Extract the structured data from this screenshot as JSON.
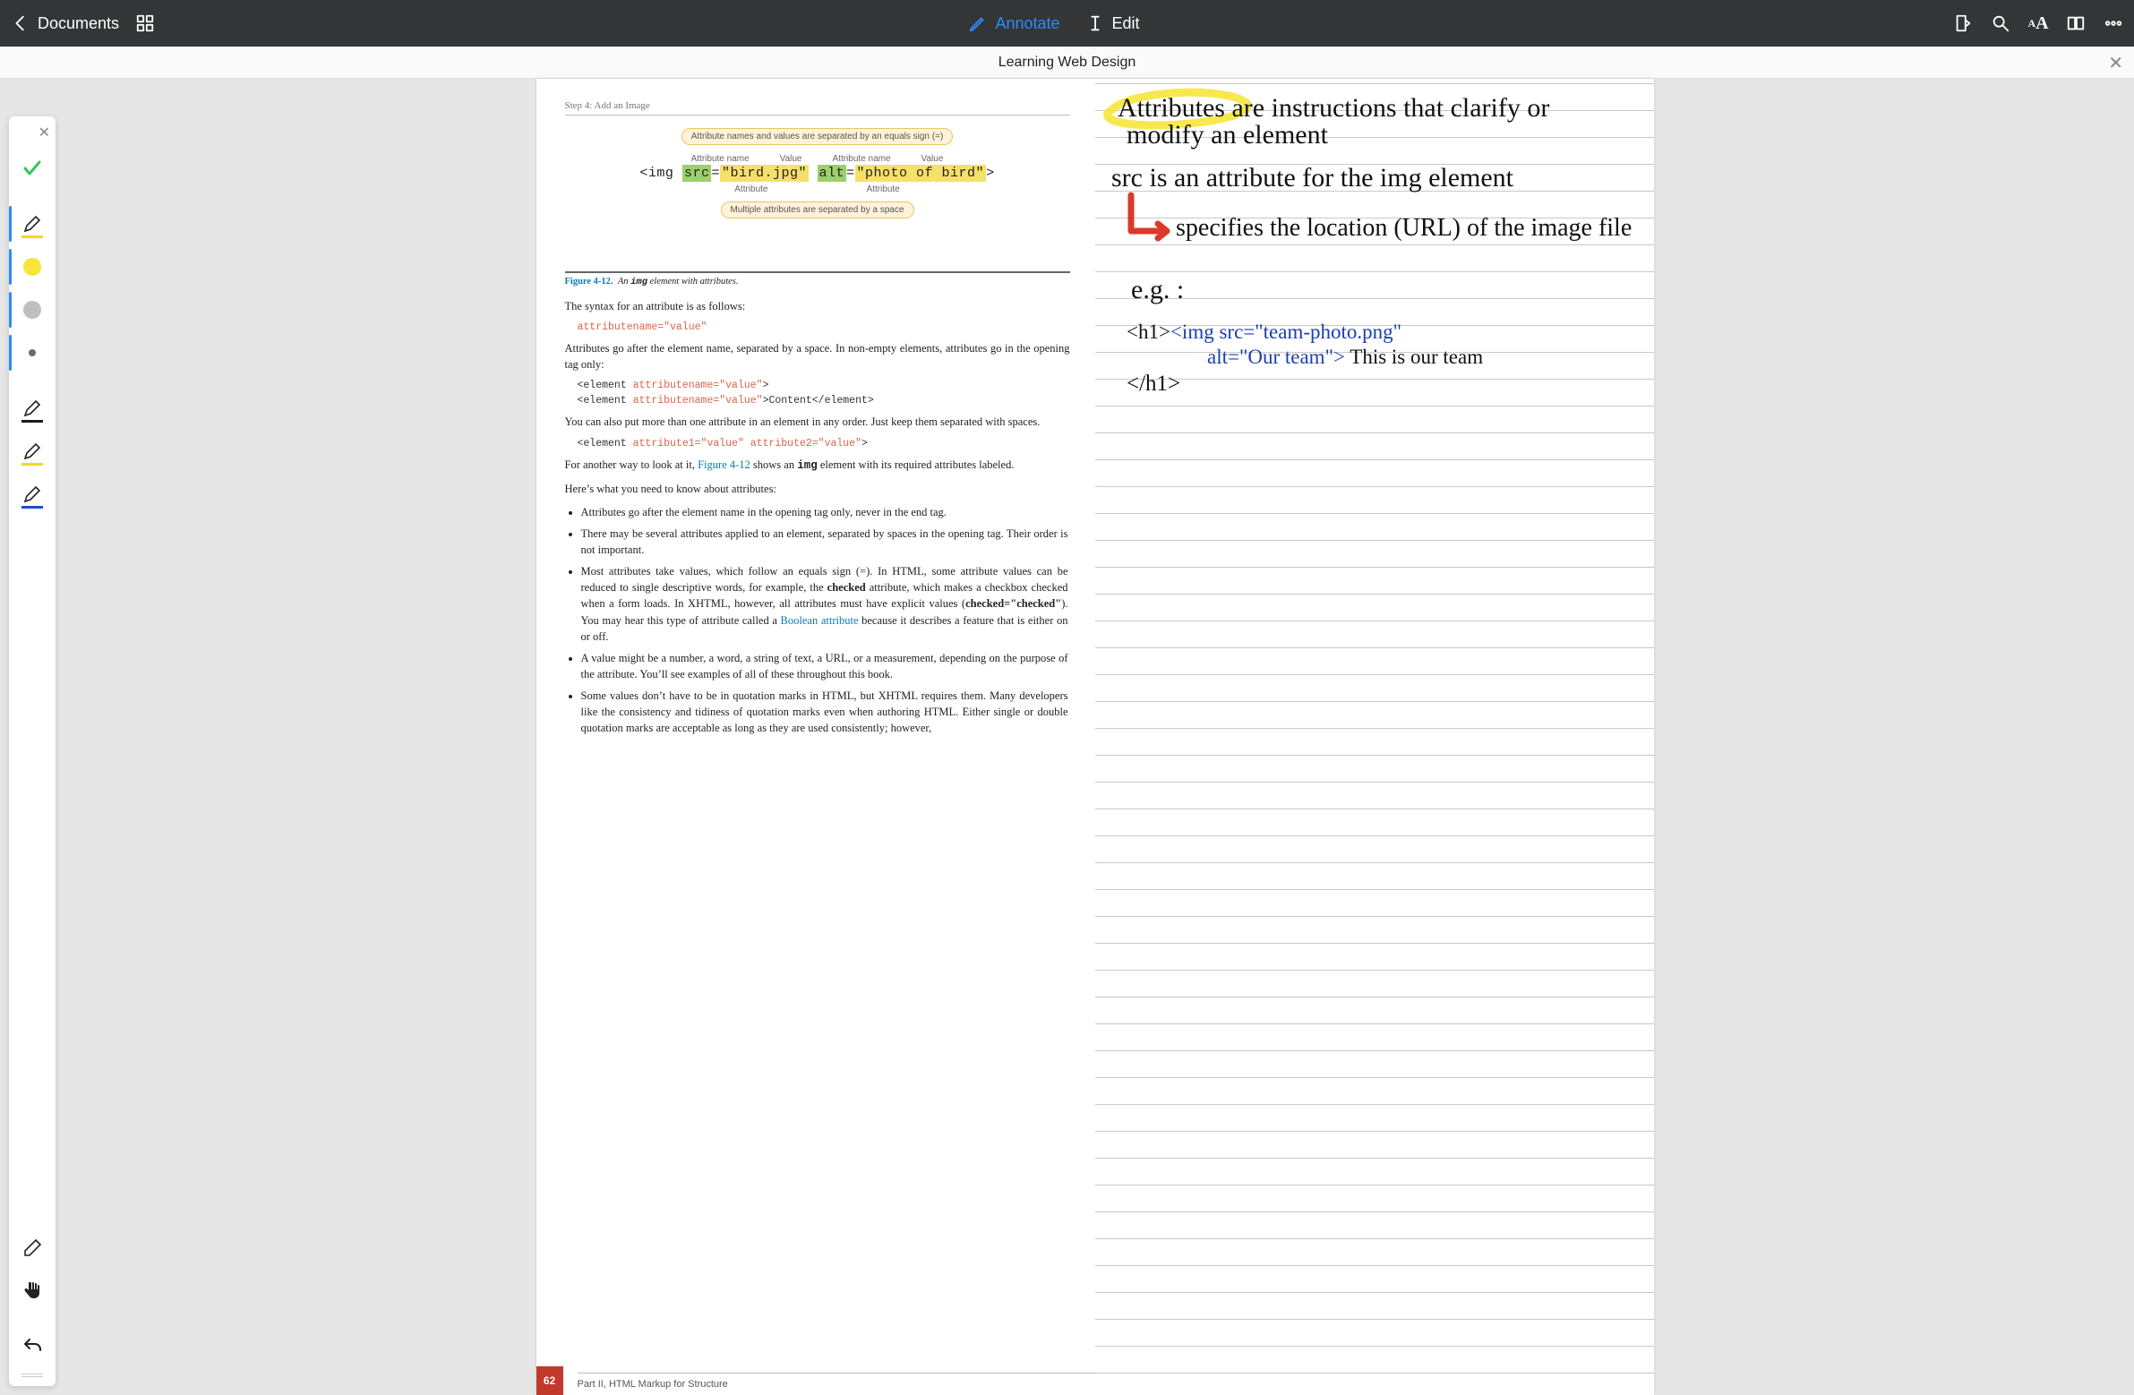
{
  "toolbar": {
    "back_label": "Documents",
    "mode_annotate": "Annotate",
    "mode_edit": "Edit"
  },
  "titlebar": {
    "doc_title": "Learning Web Design"
  },
  "palette": {
    "tools": [
      {
        "name": "done-check",
        "type": "check"
      },
      {
        "name": "pen-tool-yellow",
        "type": "pen",
        "underline": "#f2d531"
      },
      {
        "name": "color-yellow",
        "type": "swatch",
        "color": "#f6e63c"
      },
      {
        "name": "color-gray",
        "type": "swatch",
        "color": "#bfbfbf"
      },
      {
        "name": "color-dot",
        "type": "swatch",
        "color": "#6b6b6b",
        "small": true
      },
      {
        "name": "pen-black",
        "type": "pen",
        "underline": "#1c1c1c"
      },
      {
        "name": "pen-yellow2",
        "type": "pen",
        "underline": "#f2d531"
      },
      {
        "name": "pen-blue",
        "type": "pen",
        "underline": "#1850c9"
      },
      {
        "name": "eraser-tool",
        "type": "eraser"
      },
      {
        "name": "hand-tool",
        "type": "hand"
      },
      {
        "name": "undo-tool",
        "type": "undo"
      }
    ]
  },
  "book": {
    "step_header": "Step 4: Add an Image",
    "diagram": {
      "callout_top": "Attribute names and values are separated by an equals sign (=)",
      "label_attr_name": "Attribute name",
      "label_value": "Value",
      "code": "<img src=\"bird.jpg\" alt=\"photo of bird\">",
      "code_parts": {
        "open": "<img ",
        "a1n": "src",
        "eq": "=",
        "a1v": "\"bird.jpg\"",
        "sp": " ",
        "a2n": "alt",
        "a2v": "\"photo of bird\"",
        "close": ">"
      },
      "label_attribute": "Attribute",
      "callout_bot": "Multiple attributes are separated by a space"
    },
    "fig": {
      "num": "Figure 4-12.",
      "rest_a": "An ",
      "mono": "img",
      "rest_b": " element with attributes."
    },
    "p1": "The syntax for an attribute is as follows:",
    "code1": "attributename=\"value\"",
    "p2": "Attributes go after the element name, separated by a space. In non-empty elements, attributes go in the opening tag only:",
    "code2a_pre": "<element ",
    "code2a_attr": "attributename=\"value\"",
    "code2a_post": ">",
    "code2b_pre": "<element ",
    "code2b_attr": "attributename=\"value\"",
    "code2b_post": ">Content</element>",
    "p3": "You can also put more than one attribute in an element in any order. Just keep them separated with spaces.",
    "code3_pre": "<element ",
    "code3_a1": "attribute1=\"value\"",
    "code3_sp": " ",
    "code3_a2": "attribute2=\"value\"",
    "code3_post": ">",
    "p4a": "For another way to look at it, ",
    "p4_link": "Figure 4-12",
    "p4b": " shows an ",
    "p4_mono": "img",
    "p4c": " element with its required attributes labeled.",
    "p5": "Here’s what you need to know about attributes:",
    "bullets": [
      "Attributes go after the element name in the opening tag only, never in the end tag.",
      "There may be several attributes applied to an element, separated by spaces in the opening tag. Their order is not important.",
      "",
      "A value might be a number, a word, a string of text, a URL, or a measurement, depending on the purpose of the attribute. You’ll see examples of all of these throughout this book.",
      "Some values don’t have to be in quotation marks in HTML, but XHTML requires them. Many developers like the consistency and tidiness of quotation marks even when authoring HTML. Either single or double quotation marks are acceptable as long as they are used consistently; however,"
    ],
    "bullet3": {
      "a": "Most attributes take values, which follow an equals sign (=). In HTML, some attribute values can be reduced to single descriptive words, for example, the ",
      "b_bold": "checked",
      "c": " attribute, which makes a checkbox checked when a form loads. In XHTML, however, all attributes must have explicit values (",
      "d_bold": "checked=\"checked\"",
      "e": "). You may hear this type of attribute called a ",
      "f_link": "Boolean attribute",
      "g": " because it describes a feature that is either on or off."
    },
    "page_number": "62",
    "part_label": "Part  II, HTML Markup for Structure"
  },
  "notes": {
    "line1": "Attributes are instructions that clarify or",
    "line1b": "modify an element",
    "line2": "src is an attribute for the img element",
    "line3": "specifies the location (URL) of the image file",
    "eg": "e.g. :",
    "code1": "<h1><img src=\"team-photo.png\"",
    "code2": "alt=\"Our team\"> This is our team",
    "code3": "</h1>"
  }
}
